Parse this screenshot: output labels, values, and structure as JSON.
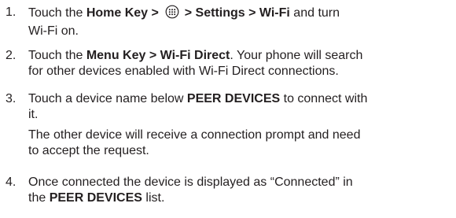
{
  "steps": [
    {
      "number": "1.",
      "line1": {
        "t0": "Touch the ",
        "b0": "Home Key > ",
        "icon": "apps-grid-icon",
        "b1": " > Settings > Wi-Fi",
        "t1": " and turn"
      },
      "line2": "Wi-Fi on."
    },
    {
      "number": "2.",
      "line1": {
        "t0": "Touch the ",
        "b0": "Menu Key > Wi-Fi Direct",
        "t1": ". Your phone will search"
      },
      "line2": "for other devices enabled with Wi-Fi Direct connections."
    },
    {
      "number": "3.",
      "line1": {
        "t0": "Touch a device name below ",
        "b0": "PEER DEVICES",
        "t1": " to connect with"
      },
      "line2": "it.",
      "note1": "The other device will receive a connection prompt and need",
      "note2": "to accept the request."
    },
    {
      "number": "4.",
      "line1": "Once connected the device is displayed as “Connected” in",
      "line2": {
        "t0": "the ",
        "b0": "PEER DEVICES",
        "t1": " list."
      }
    }
  ],
  "colors": {
    "text": "#231f20",
    "icon_stroke": "#231f20"
  }
}
